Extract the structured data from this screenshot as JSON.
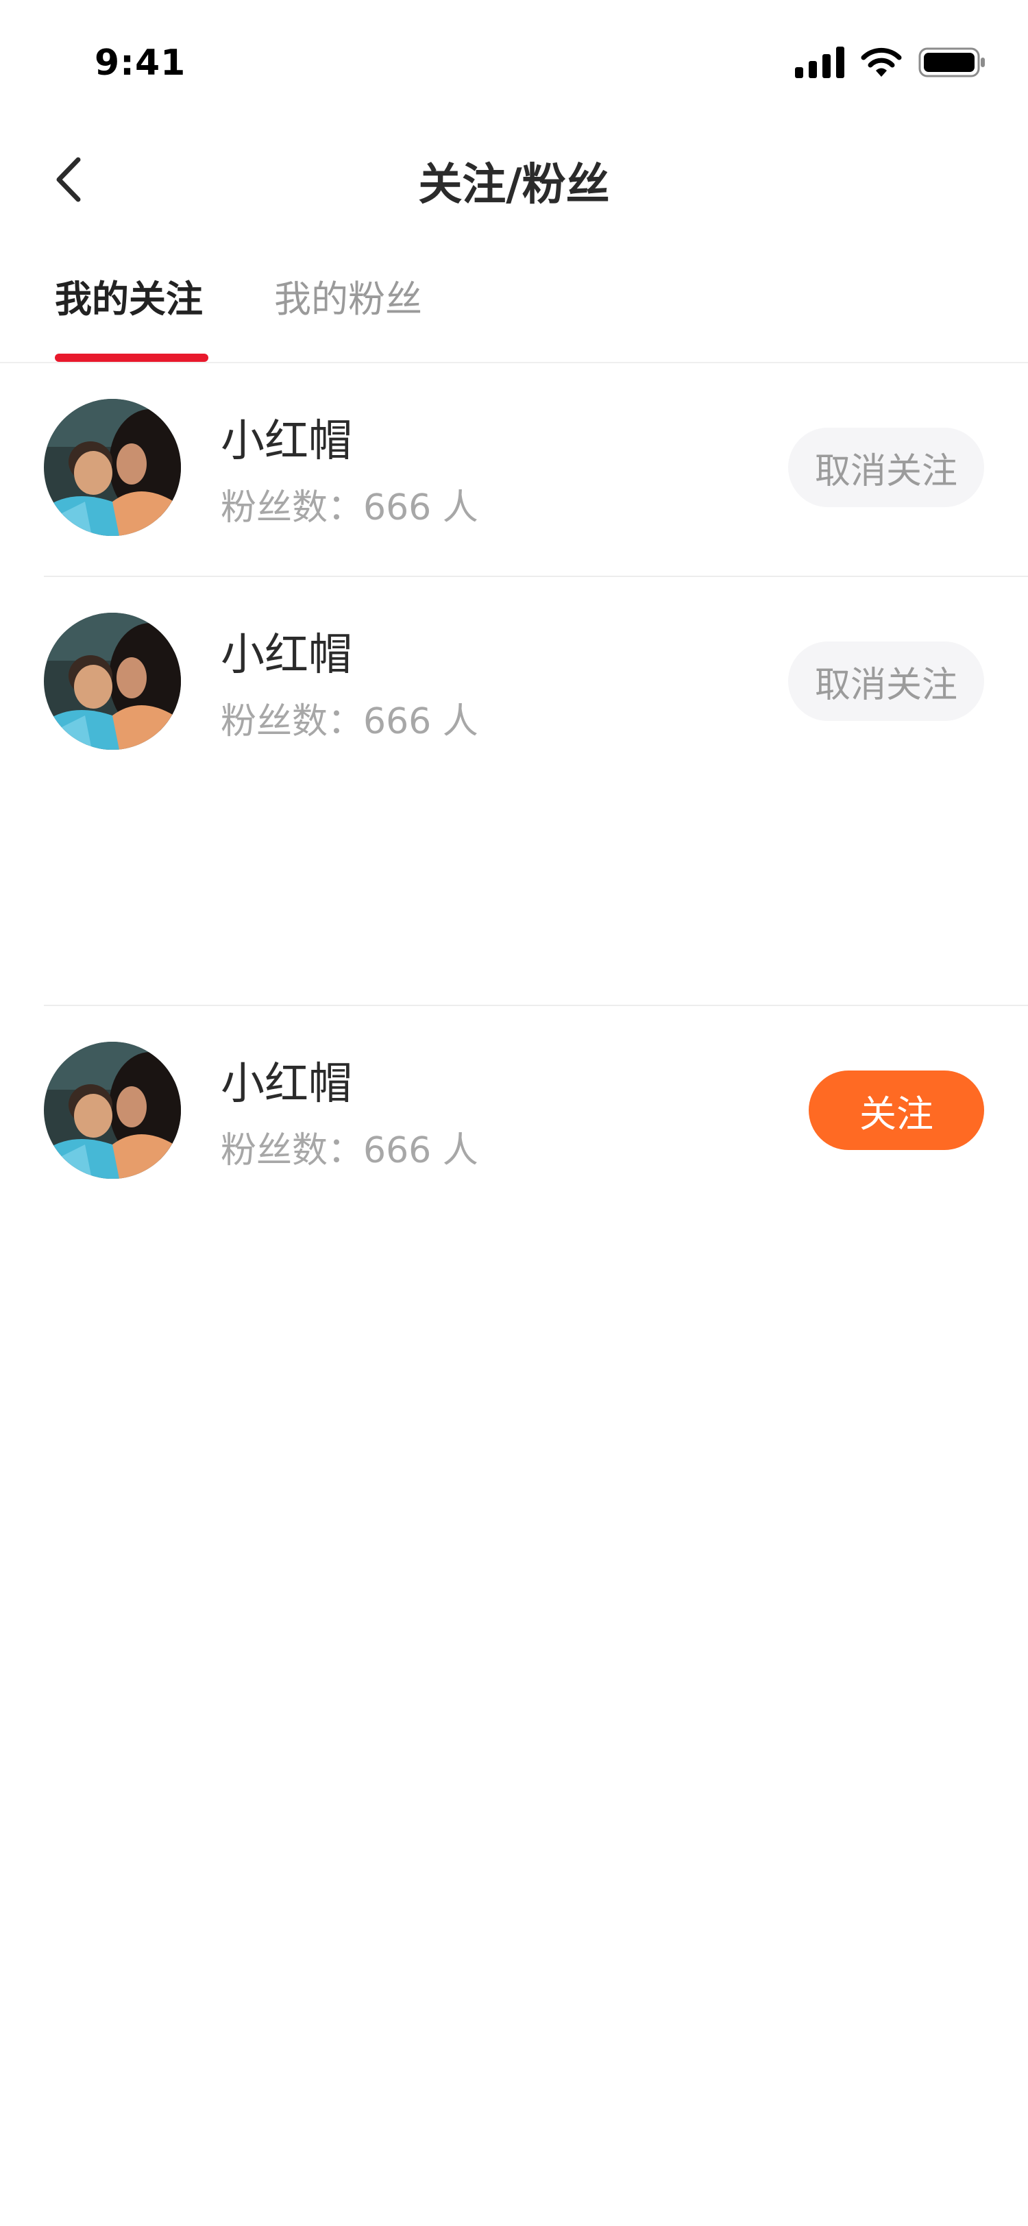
{
  "status_bar": {
    "time": "9:41",
    "icons": [
      "signal-icon",
      "wifi-icon",
      "battery-icon"
    ]
  },
  "nav": {
    "back_icon": "chevron-left-icon",
    "title": "关注/粉丝"
  },
  "tabs": [
    {
      "label": "我的关注",
      "active": true
    },
    {
      "label": "我的粉丝",
      "active": false
    }
  ],
  "colors": {
    "accent_red": "#e8192c",
    "follow_orange": "#ff6a23",
    "muted_gray": "#a7a7a7",
    "unfollow_bg": "#f5f5f7"
  },
  "users": [
    {
      "name": "小红帽",
      "fans": "粉丝数：666 人",
      "action": "取消关注",
      "followed": true,
      "avatar_icon": "user-photo-avatar"
    },
    {
      "name": "小红帽",
      "fans": "粉丝数：666 人",
      "action": "取消关注",
      "followed": true,
      "avatar_icon": "user-photo-avatar"
    },
    {
      "name": "小红帽",
      "fans": "粉丝数：666 人",
      "action": "关注",
      "followed": false,
      "avatar_icon": "user-photo-avatar"
    }
  ]
}
